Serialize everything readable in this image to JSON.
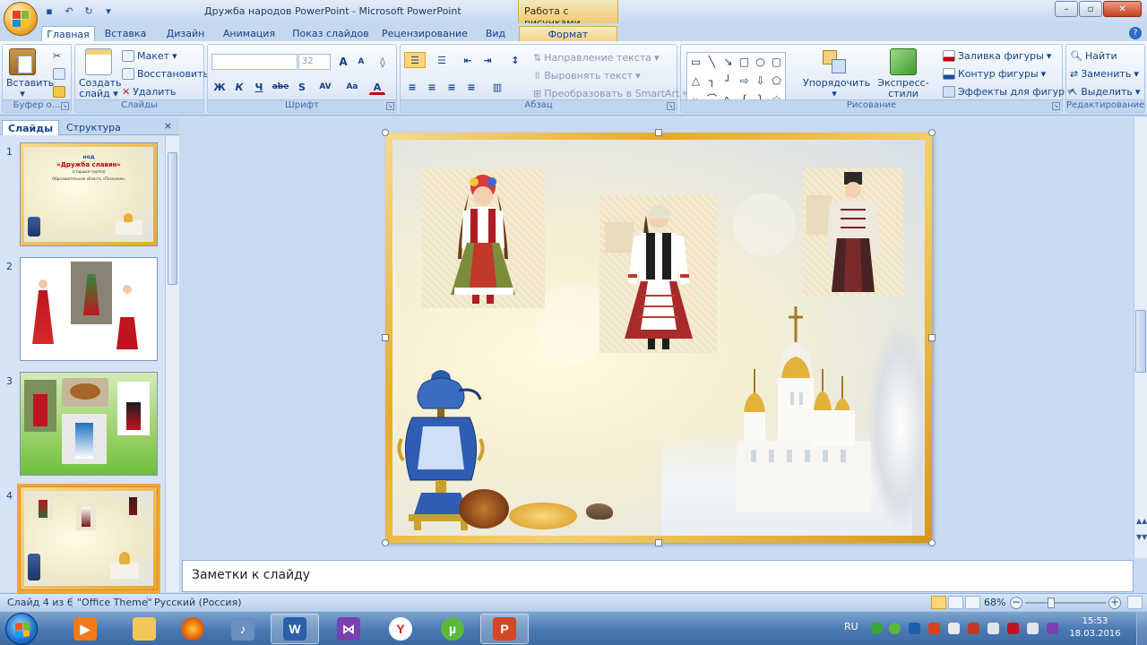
{
  "window": {
    "title": "Дружба народов PowerPoint - Microsoft PowerPoint",
    "context_tab_group": "Работа с рисунками",
    "buttons": {
      "minimize": "–",
      "maximize": "▫",
      "close": "✕"
    }
  },
  "ribbon_tabs": [
    "Главная",
    "Вставка",
    "Дизайн",
    "Анимация",
    "Показ слайдов",
    "Рецензирование",
    "Вид",
    "Формат"
  ],
  "ribbon": {
    "clipboard": {
      "label": "Буфер о...",
      "paste": "Вставить"
    },
    "slides": {
      "label": "Слайды",
      "new_slide_line1": "Создать",
      "new_slide_line2": "слайд",
      "layout": "Макет",
      "reset": "Восстановить",
      "delete": "Удалить"
    },
    "font": {
      "label": "Шрифт",
      "font_name": "",
      "font_size": "32",
      "bold": "Ж",
      "italic": "К",
      "underline": "Ч",
      "strike": "abe",
      "shadow": "S",
      "spacing": "AV",
      "case": "Aa",
      "color": "A",
      "grow": "A",
      "shrink": "A"
    },
    "paragraph": {
      "label": "Абзац",
      "text_direction": "Направление текста",
      "align_text": "Выровнять текст",
      "smartart": "Преобразовать в SmartArt"
    },
    "drawing": {
      "label": "Рисование",
      "arrange": "Упорядочить",
      "quick_styles": "Экспресс-стили",
      "fill": "Заливка фигуры",
      "outline": "Контур фигуры",
      "effects": "Эффекты для фигур"
    },
    "editing": {
      "label": "Редактирование",
      "find": "Найти",
      "replace": "Заменить",
      "select": "Выделить"
    }
  },
  "slides_pane": {
    "tabs": [
      "Слайды",
      "Структура"
    ],
    "close": "×",
    "thumbs": [
      {
        "num": "1",
        "line1": "нод",
        "line2": "«Дружба славян»",
        "line3": "(старшая группа)",
        "line4": "Образовательная область «Познание»"
      },
      {
        "num": "2"
      },
      {
        "num": "3"
      },
      {
        "num": "4"
      }
    ]
  },
  "notes": {
    "placeholder": "Заметки к слайду"
  },
  "status": {
    "slide": "Слайд 4 из 6",
    "theme": "\"Office Theme\"",
    "language": "Русский (Россия)",
    "zoom": "68%",
    "zoom_minus": "−",
    "zoom_plus": "+"
  },
  "taskbar": {
    "lang": "RU",
    "time": "15:53",
    "date": "18.03.2016"
  },
  "colors": {
    "slide_frame": "#e7a92a",
    "ribbon_bg": "#dfe9f7",
    "taskbar": "#4c7bb3",
    "selection": "#f2a53b"
  }
}
